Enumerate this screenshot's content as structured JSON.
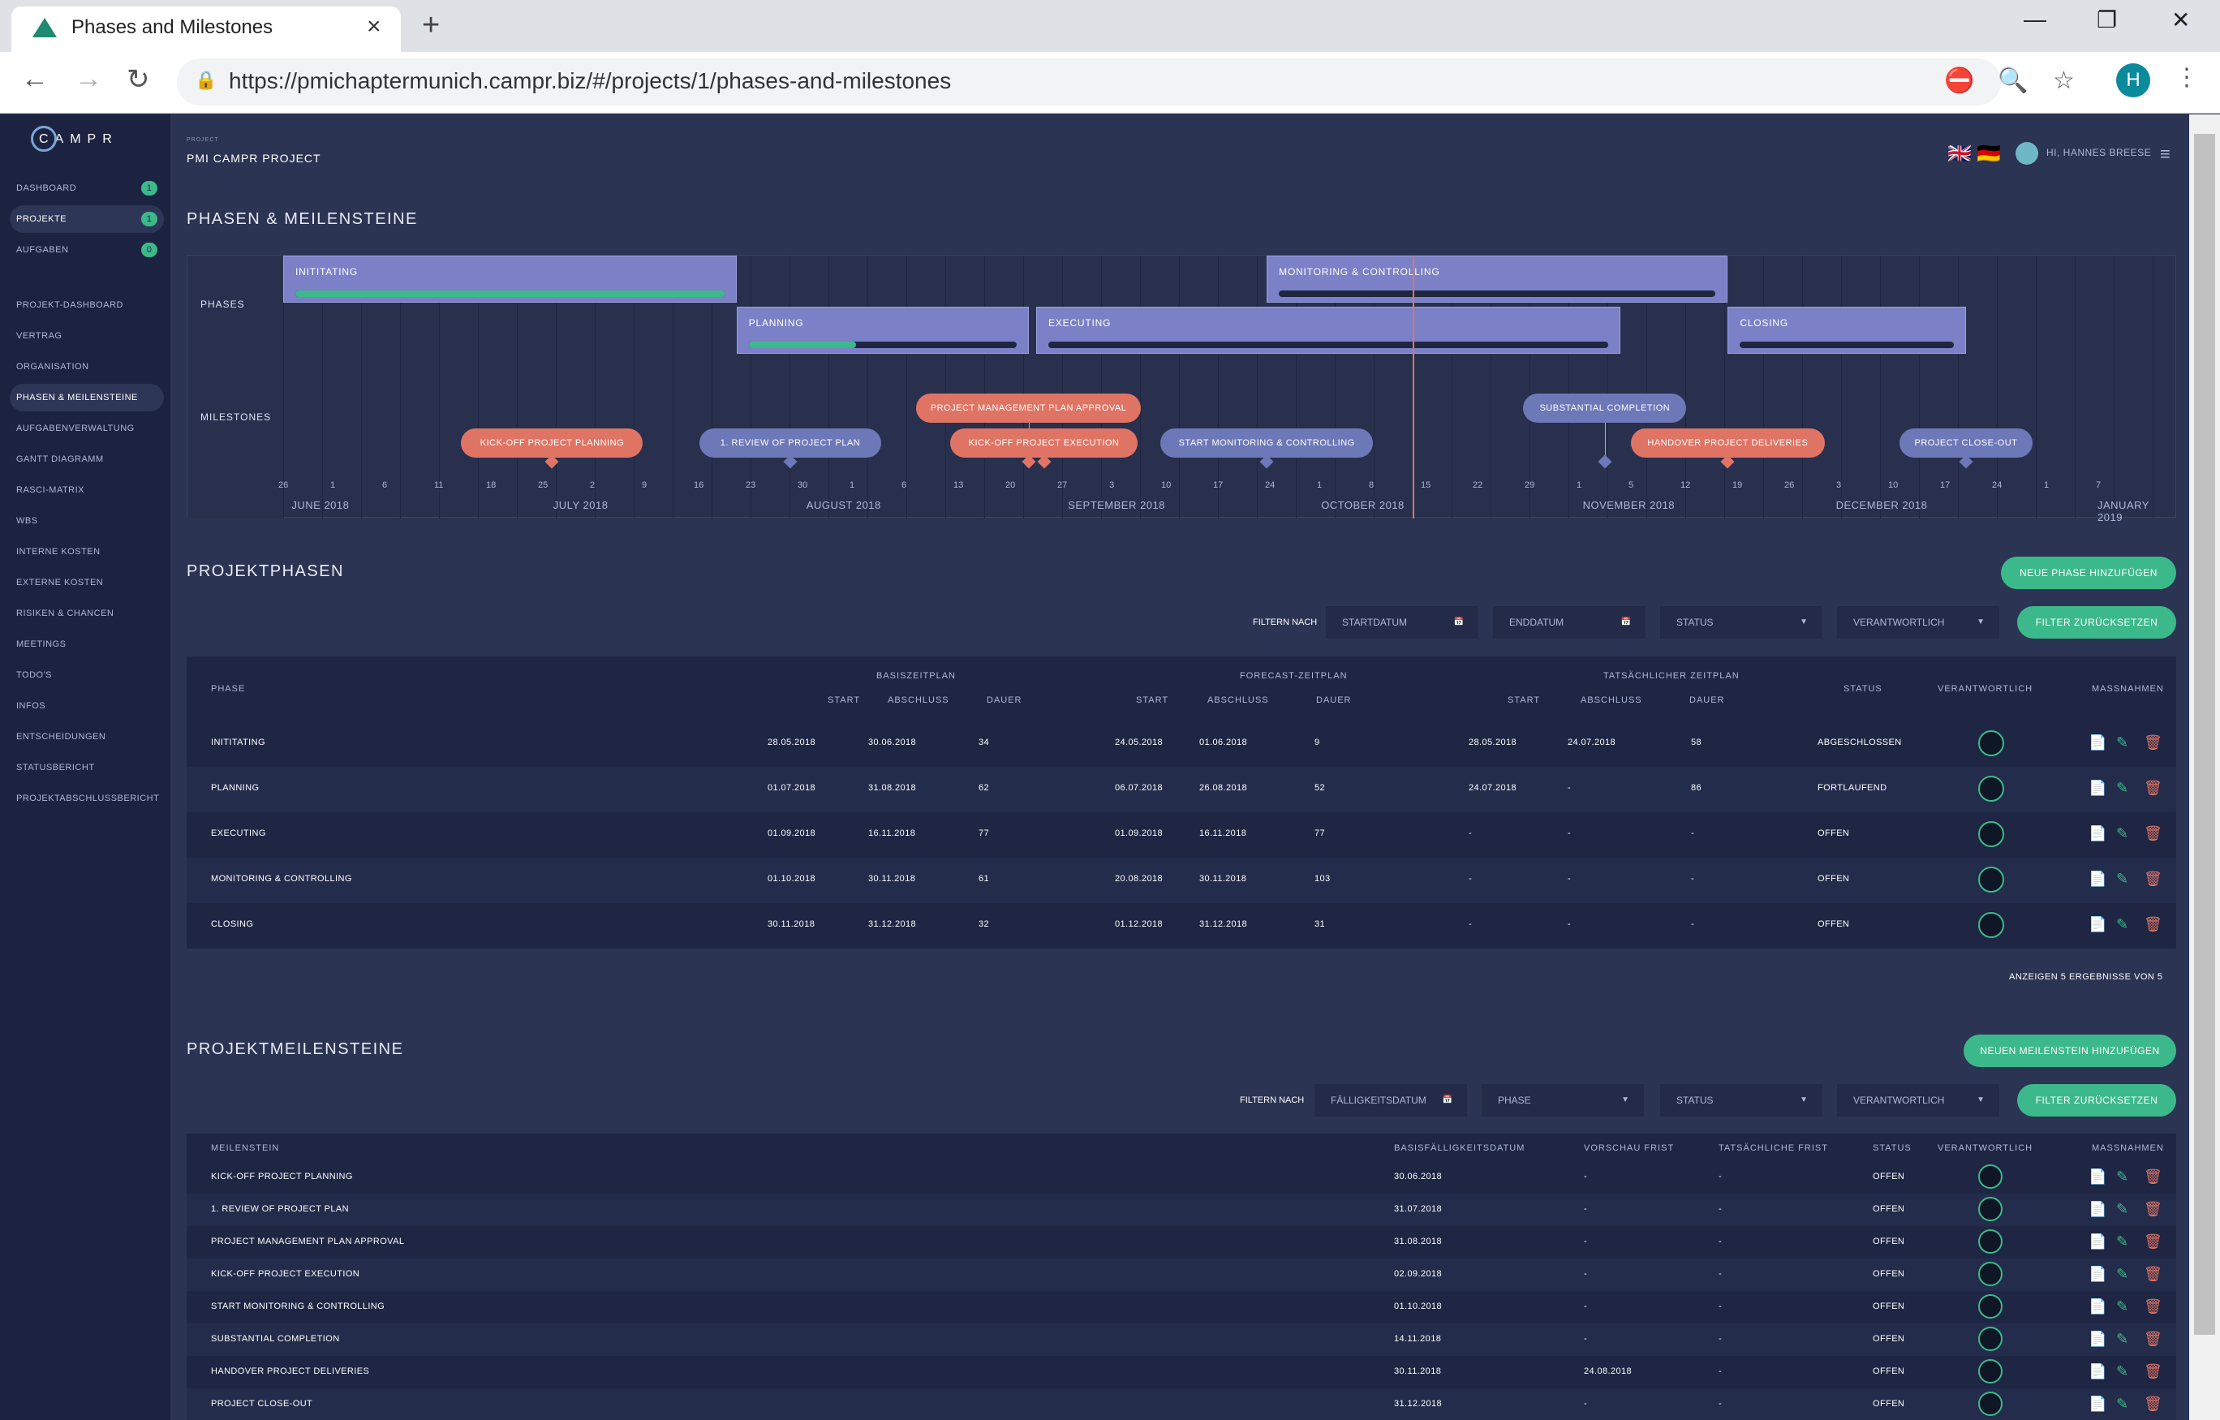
{
  "browser": {
    "tab_title": "Phases and Milestones",
    "tab_close": "×",
    "newtab": "+",
    "url": "https://pmichaptermunich.campr.biz/#/projects/1/phases-and-milestones",
    "avatar": "H",
    "icons": {
      "back": "←",
      "forward": "→",
      "reload": "↻",
      "lock": "🔒",
      "zoom": "🔍",
      "star": "☆",
      "kebab": "⋮",
      "minimize": "—",
      "maximize": "❐",
      "close": "✕",
      "blocked": "⛔"
    }
  },
  "sidebar": {
    "logo": "CAMPR",
    "top_items": [
      {
        "label": "DASHBOARD",
        "badge": "1"
      },
      {
        "label": "PROJEKTE",
        "badge": "1",
        "active": true
      },
      {
        "label": "AUFGABEN",
        "badge": "0"
      }
    ],
    "items": [
      "PROJEKT-DASHBOARD",
      "VERTRAG",
      "ORGANISATION",
      "PHASEN & MEILENSTEINE",
      "AUFGABENVERWALTUNG",
      "GANTT DIAGRAMM",
      "RASCI-MATRIX",
      "WBS",
      "INTERNE KOSTEN",
      "EXTERNE KOSTEN",
      "RISIKEN & CHANCEN",
      "MEETINGS",
      "TODO'S",
      "INFOS",
      "ENTSCHEIDUNGEN",
      "STATUSBERICHT",
      "PROJEKTABSCHLUSSBERICHT"
    ],
    "active_item": "PHASEN & MEILENSTEINE"
  },
  "header": {
    "project_label": "PROJECT",
    "project_name": "PMI CAMPR PROJECT",
    "greeting": "HI, HANNES BREESE",
    "menu_icon": "≡"
  },
  "section1_title": "PHASEN & MEILENSTEINE",
  "timeline": {
    "row_phases": "PHASES",
    "row_milestones": "MILESTONES",
    "start_date": "2018-05-26",
    "today": "2018-10-20",
    "phases": [
      {
        "label": "INITITATING",
        "start": "2018-05-26",
        "end": "2018-07-24",
        "row": 0,
        "progress": 1.0
      },
      {
        "label": "MONITORING & CONTROLLING",
        "start": "2018-10-01",
        "end": "2018-11-30",
        "row": 0,
        "progress": 0
      },
      {
        "label": "PLANNING",
        "start": "2018-07-24",
        "end": "2018-08-31",
        "row": 1,
        "progress": 0.4
      },
      {
        "label": "EXECUTING",
        "start": "2018-09-01",
        "end": "2018-11-16",
        "row": 1,
        "progress": 0
      },
      {
        "label": "CLOSING",
        "start": "2018-11-30",
        "end": "2018-12-31",
        "row": 1,
        "progress": 0
      }
    ],
    "milestones": [
      {
        "label": "KICK-OFF PROJECT PLANNING",
        "date": "2018-06-30",
        "lane": 1,
        "done": true
      },
      {
        "label": "1. REVIEW OF PROJECT PLAN",
        "date": "2018-07-31",
        "lane": 1,
        "done": false
      },
      {
        "label": "PROJECT MANAGEMENT PLAN APPROVAL",
        "date": "2018-08-31",
        "lane": 0,
        "done": true
      },
      {
        "label": "KICK-OFF PROJECT EXECUTION",
        "date": "2018-09-02",
        "lane": 1,
        "done": true
      },
      {
        "label": "START MONITORING & CONTROLLING",
        "date": "2018-10-01",
        "lane": 1,
        "done": false
      },
      {
        "label": "SUBSTANTIAL COMPLETION",
        "date": "2018-11-14",
        "lane": 0,
        "done": false
      },
      {
        "label": "HANDOVER PROJECT DELIVERIES",
        "date": "2018-11-30",
        "lane": 1,
        "done": true
      },
      {
        "label": "PROJECT CLOSE-OUT",
        "date": "2018-12-31",
        "lane": 1,
        "done": false
      }
    ],
    "day_ticks": [
      "26",
      "1",
      "6",
      "11",
      "18",
      "25",
      "2",
      "9",
      "16",
      "23",
      "30",
      "1",
      "6",
      "13",
      "20",
      "27",
      "3",
      "10",
      "17",
      "24",
      "1",
      "8",
      "15",
      "22",
      "29",
      "1",
      "5",
      "12",
      "19",
      "26",
      "3",
      "10",
      "17",
      "24",
      "1",
      "7"
    ],
    "months": [
      "JUNE 2018",
      "JULY 2018",
      "AUGUST 2018",
      "SEPTEMBER 2018",
      "OCTOBER 2018",
      "NOVEMBER 2018",
      "DECEMBER 2018",
      "JANUARY 2019"
    ]
  },
  "phases_section": {
    "title": "PROJEKTPHASEN",
    "add_button": "NEUE PHASE HINZUFÜGEN",
    "filter_label": "FILTERN NACH",
    "filters": [
      "STARTDATUM",
      "ENDDATUM",
      "STATUS",
      "VERANTWORTLICH"
    ],
    "reset_button": "FILTER ZURÜCKSETZEN",
    "group_headers": [
      "BASISZEITPLAN",
      "FORECAST-ZEITPLAN",
      "TATSÄCHLICHER ZEITPLAN"
    ],
    "col_headers": [
      "PHASE",
      "START",
      "ABSCHLUSS",
      "DAUER",
      "START",
      "ABSCHLUSS",
      "DAUER",
      "START",
      "ABSCHLUSS",
      "DAUER",
      "STATUS",
      "VERANTWORTLICH",
      "MASSNAHMEN"
    ],
    "rows": [
      [
        "INITITATING",
        "28.05.2018",
        "30.06.2018",
        "34",
        "24.05.2018",
        "01.06.2018",
        "9",
        "28.05.2018",
        "24.07.2018",
        "58",
        "ABGESCHLOSSEN"
      ],
      [
        "PLANNING",
        "01.07.2018",
        "31.08.2018",
        "62",
        "06.07.2018",
        "26.08.2018",
        "52",
        "24.07.2018",
        "-",
        "86",
        "FORTLAUFEND"
      ],
      [
        "EXECUTING",
        "01.09.2018",
        "16.11.2018",
        "77",
        "01.09.2018",
        "16.11.2018",
        "77",
        "-",
        "-",
        "-",
        "OFFEN"
      ],
      [
        "MONITORING & CONTROLLING",
        "01.10.2018",
        "30.11.2018",
        "61",
        "20.08.2018",
        "30.11.2018",
        "103",
        "-",
        "-",
        "-",
        "OFFEN"
      ],
      [
        "CLOSING",
        "30.11.2018",
        "31.12.2018",
        "32",
        "01.12.2018",
        "31.12.2018",
        "31",
        "-",
        "-",
        "-",
        "OFFEN"
      ]
    ],
    "footer": "ANZEIGEN 5 ERGEBNISSE VON 5"
  },
  "milestones_section": {
    "title": "PROJEKTMEILENSTEINE",
    "add_button": "NEUEN MEILENSTEIN HINZUFÜGEN",
    "filter_label": "FILTERN NACH",
    "filters": [
      "FÄLLIGKEITSDATUM",
      "PHASE",
      "STATUS",
      "VERANTWORTLICH"
    ],
    "reset_button": "FILTER ZURÜCKSETZEN",
    "col_headers": [
      "MEILENSTEIN",
      "BASISFÄLLIGKEITSDATUM",
      "VORSCHAU FRIST",
      "TATSÄCHLICHE FRIST",
      "STATUS",
      "VERANTWORTLICH",
      "MASSNAHMEN"
    ],
    "rows": [
      [
        "KICK-OFF PROJECT PLANNING",
        "30.06.2018",
        "-",
        "-",
        "OFFEN"
      ],
      [
        "1. REVIEW OF PROJECT PLAN",
        "31.07.2018",
        "-",
        "-",
        "OFFEN"
      ],
      [
        "PROJECT MANAGEMENT PLAN APPROVAL",
        "31.08.2018",
        "-",
        "-",
        "OFFEN"
      ],
      [
        "KICK-OFF PROJECT EXECUTION",
        "02.09.2018",
        "-",
        "-",
        "OFFEN"
      ],
      [
        "START MONITORING & CONTROLLING",
        "01.10.2018",
        "-",
        "-",
        "OFFEN"
      ],
      [
        "SUBSTANTIAL COMPLETION",
        "14.11.2018",
        "-",
        "-",
        "OFFEN"
      ],
      [
        "HANDOVER PROJECT DELIVERIES",
        "30.11.2018",
        "24.08.2018",
        "-",
        "OFFEN"
      ],
      [
        "PROJECT CLOSE-OUT",
        "31.12.2018",
        "-",
        "-",
        "OFFEN"
      ]
    ]
  },
  "icons": {
    "calendar": "📅",
    "caret": "▼",
    "view": "📄",
    "edit": "✎",
    "delete": "🗑",
    "uk_flag": "🇬🇧",
    "de_flag": "🇩🇪"
  },
  "colors": {
    "accent": "#3cb98a",
    "milestone_done": "#e07464",
    "milestone_open": "#6d78b8",
    "phase_bar": "#7b80c7",
    "today_line": "#e07464",
    "delete": "#e07464"
  }
}
